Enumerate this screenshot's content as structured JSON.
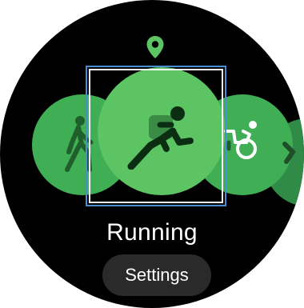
{
  "workout": {
    "title": "Running"
  },
  "buttons": {
    "settings_label": "Settings"
  },
  "icons": {
    "location": "location-pin-icon",
    "walking": "walking-icon",
    "running": "running-icon",
    "wheelchair": "wheelchair-icon"
  },
  "colors": {
    "background": "#000000",
    "accent_green": "#5cc463",
    "side_green": "#3fae55",
    "selection_border": "#4a8fd6",
    "text": "#ffffff",
    "button_bg": "#2a2a2a"
  }
}
